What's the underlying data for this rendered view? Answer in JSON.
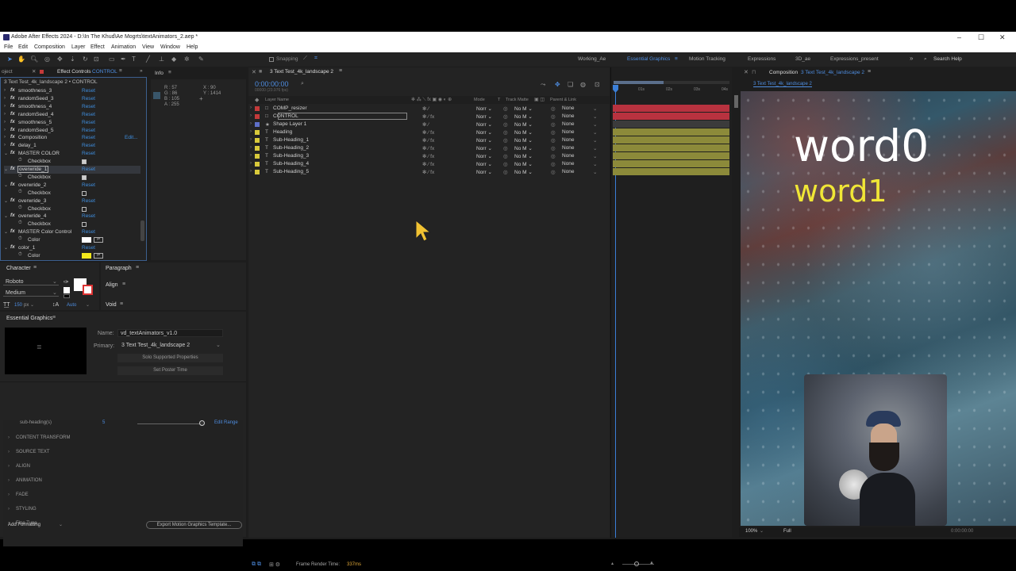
{
  "window": {
    "title": "Adobe After Effects 2024 - D:\\In The Khud\\Ae Mogrts\\textAnimators_2.aep *"
  },
  "menu": [
    "File",
    "Edit",
    "Composition",
    "Layer",
    "Effect",
    "Animation",
    "View",
    "Window",
    "Help"
  ],
  "toolbar": {
    "snapping_label": "Snapping",
    "workspaces": [
      "Working_Ae",
      "Essential Graphics",
      "Motion Tracking",
      "Expressions",
      "3D_ae",
      "Expressions_present"
    ],
    "active_workspace": "Essential Graphics",
    "search_help": "Search Help"
  },
  "effect_controls": {
    "tab_project": "oject",
    "tab_label": "Effect Controls",
    "tab_layer": "CONTROL",
    "header": "3 Text Test_4k_landscape 2 • CONTROL",
    "reset": "Reset",
    "edit": "Edit...",
    "rows": [
      {
        "kind": "fx",
        "name": "smoothness_3",
        "link": "Reset"
      },
      {
        "kind": "fx",
        "name": "randomSeed_3",
        "link": "Reset"
      },
      {
        "kind": "fx",
        "name": "smoothness_4",
        "link": "Reset"
      },
      {
        "kind": "fx",
        "name": "randomSeed_4",
        "link": "Reset"
      },
      {
        "kind": "fx",
        "name": "smoothness_5",
        "link": "Reset"
      },
      {
        "kind": "fx",
        "name": "randomSeed_5",
        "link": "Reset"
      },
      {
        "kind": "fx",
        "name": "Composition",
        "link": "Reset",
        "extra": "Edit..."
      },
      {
        "kind": "fx",
        "name": "delay_1",
        "link": "Reset"
      },
      {
        "kind": "fx",
        "name": "MASTER COLOR",
        "link": "Reset"
      },
      {
        "kind": "sub",
        "name": "Checkbox",
        "checked": true
      },
      {
        "kind": "fx",
        "name": "overwride_1",
        "link": "Reset",
        "selected": true
      },
      {
        "kind": "sub",
        "name": "Checkbox",
        "checked": true
      },
      {
        "kind": "fx",
        "name": "overwride_2",
        "link": "Reset"
      },
      {
        "kind": "sub",
        "name": "Checkbox",
        "checked": false
      },
      {
        "kind": "fx",
        "name": "overwride_3",
        "link": "Reset"
      },
      {
        "kind": "sub",
        "name": "Checkbox",
        "checked": false
      },
      {
        "kind": "fx",
        "name": "overwride_4",
        "link": "Reset"
      },
      {
        "kind": "sub",
        "name": "Checkbox",
        "checked": false
      },
      {
        "kind": "fx",
        "name": "MASTER Color Control",
        "link": "Reset"
      },
      {
        "kind": "color",
        "name": "Color",
        "swatch": "#ffffff"
      },
      {
        "kind": "fx",
        "name": "color_1",
        "link": "Reset"
      },
      {
        "kind": "color",
        "name": "Color",
        "swatch": "#f3e81c"
      }
    ]
  },
  "info": {
    "title": "Info",
    "r": "R : 57",
    "g": "G : 86",
    "b": "B : 105",
    "a": "A : 255",
    "x": "X : 90",
    "y": "Y : 1414",
    "swatch": "#39566a"
  },
  "character": {
    "title": "Character",
    "font": "Roboto",
    "style": "Medium",
    "size": "150",
    "size_unit": "px",
    "leading": "Auto"
  },
  "paragraph": {
    "title": "Paragraph"
  },
  "align": {
    "title": "Align"
  },
  "void": {
    "title": "Void"
  },
  "essential_graphics": {
    "title": "Essential Graphics",
    "name_label": "Name:",
    "name_value": "vd_textAnimators_v1.0",
    "primary_label": "Primary:",
    "primary_value": "3 Text Test_4k_landscape 2",
    "solo_btn": "Solo Supported Properties",
    "poster_btn": "Set Poster Time",
    "slider_label": "sub-heading(s)",
    "slider_value": "5",
    "slider_level": 1.0,
    "edit_range": "Edit Range",
    "sections": [
      "CONTENT TRANSFORM",
      "SOURCE TEXT",
      "ALIGN",
      "ANIMATION",
      "FADE",
      "STYLING",
      "Fine Tune"
    ],
    "add_formatting": "Add Formatting",
    "export_btn": "Export Motion Graphics Template..."
  },
  "timeline": {
    "tab": "3 Text Test_4k_landscape 2",
    "timecode": "0:00:00:00",
    "fps": "00000 (23.976 fps)",
    "col_layer_name": "Layer Name",
    "col_mode": "Mode",
    "col_t": "T",
    "col_track": "Track Matte",
    "col_parent": "Parent & Link",
    "ruler": [
      "0s",
      "01s",
      "02s",
      "03s",
      "04s"
    ],
    "frame_render_label": "Frame Render Time:",
    "frame_render_value": "337ms",
    "layers": [
      {
        "name": "COMP_resizer",
        "type": "□",
        "label": "#c43a3a",
        "mode": "Norr",
        "track": "No M",
        "parent": "None",
        "bar": "#b8323f",
        "solid": true
      },
      {
        "name": "CONTROL",
        "type": "□",
        "label": "#c43a3a",
        "mode": "Norr",
        "track": "No M",
        "parent": "None",
        "bar": "#b8323f",
        "selected": true
      },
      {
        "name": "Shape Layer 1",
        "type": "★",
        "label": "#5e6fc8",
        "mode": "Norr",
        "track": "No M",
        "parent": "None",
        "bar": "#3b3b3b"
      },
      {
        "name": "Heading",
        "type": "T",
        "label": "#d8c93b",
        "mode": "Norr",
        "track": "No M",
        "parent": "None",
        "bar": "#8c8a3a"
      },
      {
        "name": "Sub-Heading_1",
        "type": "T",
        "label": "#d8c93b",
        "mode": "Norr",
        "track": "No M",
        "parent": "None",
        "bar": "#8c8a3a"
      },
      {
        "name": "Sub-Heading_2",
        "type": "T",
        "label": "#d8c93b",
        "mode": "Norr",
        "track": "No M",
        "parent": "None",
        "bar": "#8c8a3a"
      },
      {
        "name": "Sub-Heading_3",
        "type": "T",
        "label": "#d8c93b",
        "mode": "Norr",
        "track": "No M",
        "parent": "None",
        "bar": "#8c8a3a"
      },
      {
        "name": "Sub-Heading_4",
        "type": "T",
        "label": "#d8c93b",
        "mode": "Norr",
        "track": "No M",
        "parent": "None",
        "bar": "#8c8a3a"
      },
      {
        "name": "Sub-Heading_5",
        "type": "T",
        "label": "#d8c93b",
        "mode": "Norr",
        "track": "No M",
        "parent": "None",
        "bar": "#8c8a3a"
      }
    ]
  },
  "composition": {
    "title_prefix": "Composition",
    "title_name": "3 Text Test_4k_landscape 2",
    "tab": "3 Text Test_4k_landscape 2",
    "word0": "word0",
    "word1": "word1",
    "zoom": "100%",
    "resolution": "Full",
    "timecode": "0:00:00:00"
  }
}
